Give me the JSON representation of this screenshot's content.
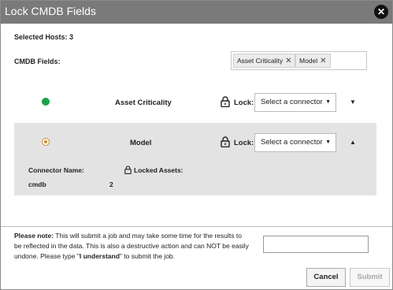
{
  "dialog": {
    "title": "Lock CMDB Fields",
    "close_icon": "close-icon"
  },
  "selected_hosts_label": "Selected Hosts: 3",
  "cmdb_fields_label": "CMDB Fields:",
  "chips": [
    {
      "label": "Asset Criticality",
      "remove": "✕"
    },
    {
      "label": "Model",
      "remove": "✕"
    }
  ],
  "fields": [
    {
      "name": "Asset Criticality",
      "status_color": "#1aa34a",
      "lock_label": "Lock:",
      "connector_placeholder": "Select a connector",
      "expanded": false,
      "expand_icon": "chevron-down-icon"
    },
    {
      "name": "Model",
      "status_color": "#d08a2e",
      "lock_label": "Lock:",
      "connector_placeholder": "Select a connector",
      "expanded": true,
      "expand_icon": "chevron-up-icon",
      "details": {
        "headers": {
          "connector_name": "Connector Name:",
          "locked_assets": "Locked Assets:"
        },
        "rows": [
          {
            "connector": "cmdb",
            "count": "2"
          }
        ]
      }
    }
  ],
  "note": {
    "prefix": "Please note:",
    "text": " This will submit a job and may take some time for the results to be reflected in the data. This is also a destructive action and can NOT be easily undone. Please type \"",
    "keyword": "I understand",
    "suffix": "\" to submit the job."
  },
  "confirm_input": {
    "value": ""
  },
  "buttons": {
    "cancel": "Cancel",
    "submit": "Submit"
  },
  "colors": {
    "titlebar": "#7a7a7a",
    "expanded_row_bg": "#e3e3e3"
  }
}
